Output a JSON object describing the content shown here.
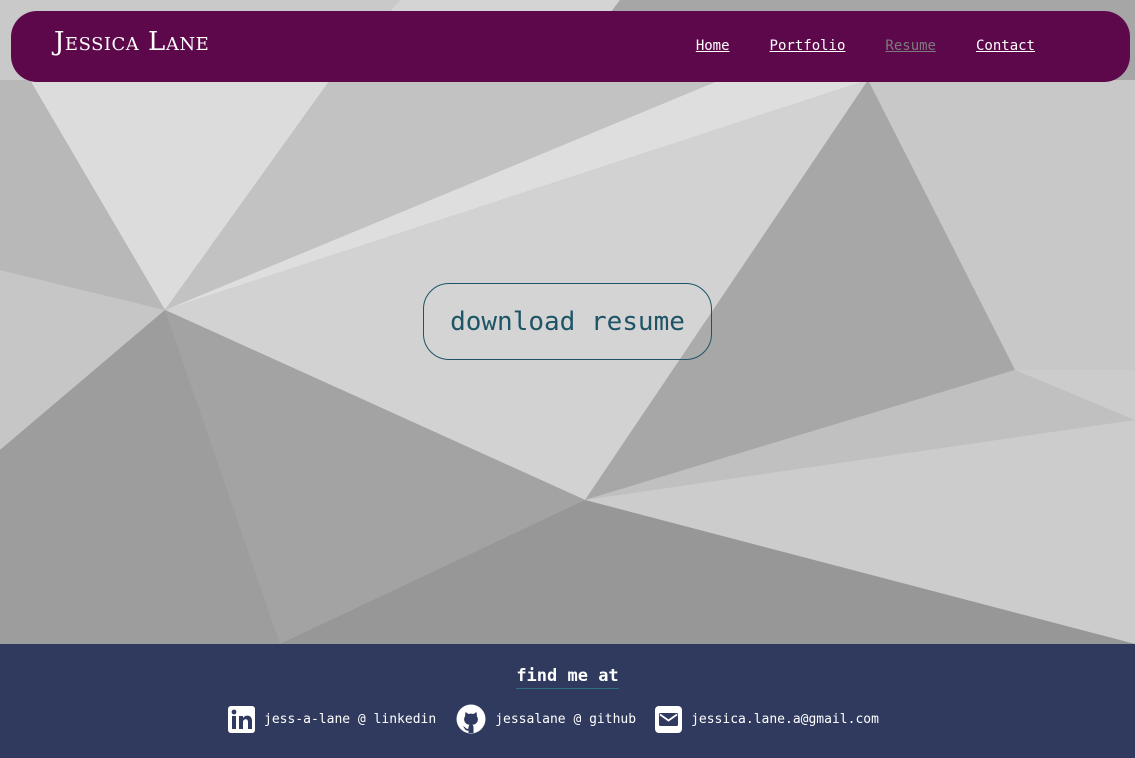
{
  "header": {
    "brand": "Jessica Lane",
    "nav": [
      {
        "label": "Home",
        "active": false
      },
      {
        "label": "Portfolio",
        "active": false
      },
      {
        "label": "Resume",
        "active": true
      },
      {
        "label": "Contact",
        "active": false
      }
    ]
  },
  "main": {
    "download_label": "download resume"
  },
  "footer": {
    "title": "find me at",
    "links": [
      {
        "icon": "linkedin-icon",
        "text": "jess-a-lane @ linkedin"
      },
      {
        "icon": "github-icon",
        "text": "jessalane @ github"
      },
      {
        "icon": "envelope-icon",
        "text": "jessica.lane.a@gmail.com"
      }
    ]
  },
  "colors": {
    "nav_background": "#5e084c",
    "footer_background": "#2f3a5e",
    "accent": "#1d5466",
    "active_link": "#7b7b7b"
  }
}
